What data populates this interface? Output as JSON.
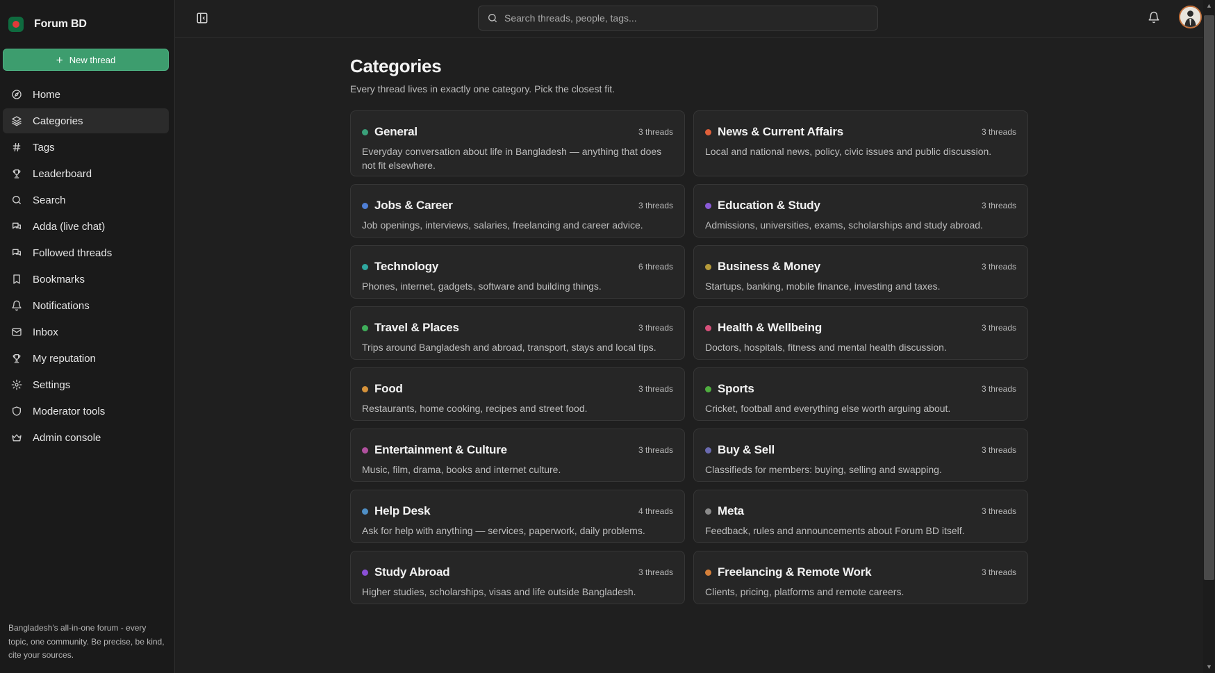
{
  "app": {
    "name": "Forum BD",
    "logo_colors": {
      "bg": "#0f6b3f",
      "circle": "#e03a3a"
    }
  },
  "sidebar": {
    "new_thread_label": "New thread",
    "items": [
      {
        "label": "Home",
        "icon": "compass-icon",
        "active": false
      },
      {
        "label": "Categories",
        "icon": "layers-icon",
        "active": true
      },
      {
        "label": "Tags",
        "icon": "hash-icon",
        "active": false
      },
      {
        "label": "Leaderboard",
        "icon": "trophy-icon",
        "active": false
      },
      {
        "label": "Search",
        "icon": "search-icon",
        "active": false
      },
      {
        "label": "Adda (live chat)",
        "icon": "chat-icon",
        "active": false
      },
      {
        "label": "Followed threads",
        "icon": "chat-icon",
        "active": false
      },
      {
        "label": "Bookmarks",
        "icon": "bookmark-icon",
        "active": false
      },
      {
        "label": "Notifications",
        "icon": "bell-icon",
        "active": false
      },
      {
        "label": "Inbox",
        "icon": "mail-icon",
        "active": false
      },
      {
        "label": "My reputation",
        "icon": "trophy-icon",
        "active": false
      },
      {
        "label": "Settings",
        "icon": "gear-icon",
        "active": false
      },
      {
        "label": "Moderator tools",
        "icon": "shield-icon",
        "active": false
      },
      {
        "label": "Admin console",
        "icon": "crown-icon",
        "active": false
      }
    ],
    "footer_text": "Bangladesh's all-in-one forum - every topic, one community. Be precise, be kind, cite your sources."
  },
  "topbar": {
    "search_placeholder": "Search threads, people, tags...",
    "accent_color": "#3d9d6e"
  },
  "page": {
    "title": "Categories",
    "subtitle": "Every thread lives in exactly one category. Pick the closest fit."
  },
  "categories": [
    {
      "name": "General",
      "count": "3 threads",
      "color": "#3aa17a",
      "desc": "Everyday conversation about life in Bangladesh — anything that does not fit elsewhere."
    },
    {
      "name": "News & Current Affairs",
      "count": "3 threads",
      "color": "#e0603a",
      "desc": "Local and national news, policy, civic issues and public discussion."
    },
    {
      "name": "Jobs & Career",
      "count": "3 threads",
      "color": "#4f7fd6",
      "desc": "Job openings, interviews, salaries, freelancing and career advice."
    },
    {
      "name": "Education & Study",
      "count": "3 threads",
      "color": "#8a5ad6",
      "desc": "Admissions, universities, exams, scholarships and study abroad."
    },
    {
      "name": "Technology",
      "count": "6 threads",
      "color": "#2fa8a0",
      "desc": "Phones, internet, gadgets, software and building things."
    },
    {
      "name": "Business & Money",
      "count": "3 threads",
      "color": "#b59a3a",
      "desc": "Startups, banking, mobile finance, investing and taxes."
    },
    {
      "name": "Travel & Places",
      "count": "3 threads",
      "color": "#3fae5a",
      "desc": "Trips around Bangladesh and abroad, transport, stays and local tips."
    },
    {
      "name": "Health & Wellbeing",
      "count": "3 threads",
      "color": "#d6507a",
      "desc": "Doctors, hospitals, fitness and mental health discussion."
    },
    {
      "name": "Food",
      "count": "3 threads",
      "color": "#d6923a",
      "desc": "Restaurants, home cooking, recipes and street food."
    },
    {
      "name": "Sports",
      "count": "3 threads",
      "color": "#4fae3f",
      "desc": "Cricket, football and everything else worth arguing about."
    },
    {
      "name": "Entertainment & Culture",
      "count": "3 threads",
      "color": "#b0509e",
      "desc": "Music, film, drama, books and internet culture."
    },
    {
      "name": "Buy & Sell",
      "count": "3 threads",
      "color": "#6a6ab0",
      "desc": "Classifieds for members: buying, selling and swapping."
    },
    {
      "name": "Help Desk",
      "count": "4 threads",
      "color": "#4f8fc6",
      "desc": "Ask for help with anything — services, paperwork, daily problems."
    },
    {
      "name": "Meta",
      "count": "3 threads",
      "color": "#8a8a8a",
      "desc": "Feedback, rules and announcements about Forum BD itself."
    },
    {
      "name": "Study Abroad",
      "count": "3 threads",
      "color": "#8a4fd6",
      "desc": "Higher studies, scholarships, visas and life outside Bangladesh."
    },
    {
      "name": "Freelancing & Remote Work",
      "count": "3 threads",
      "color": "#d6803a",
      "desc": "Clients, pricing, platforms and remote careers."
    }
  ]
}
